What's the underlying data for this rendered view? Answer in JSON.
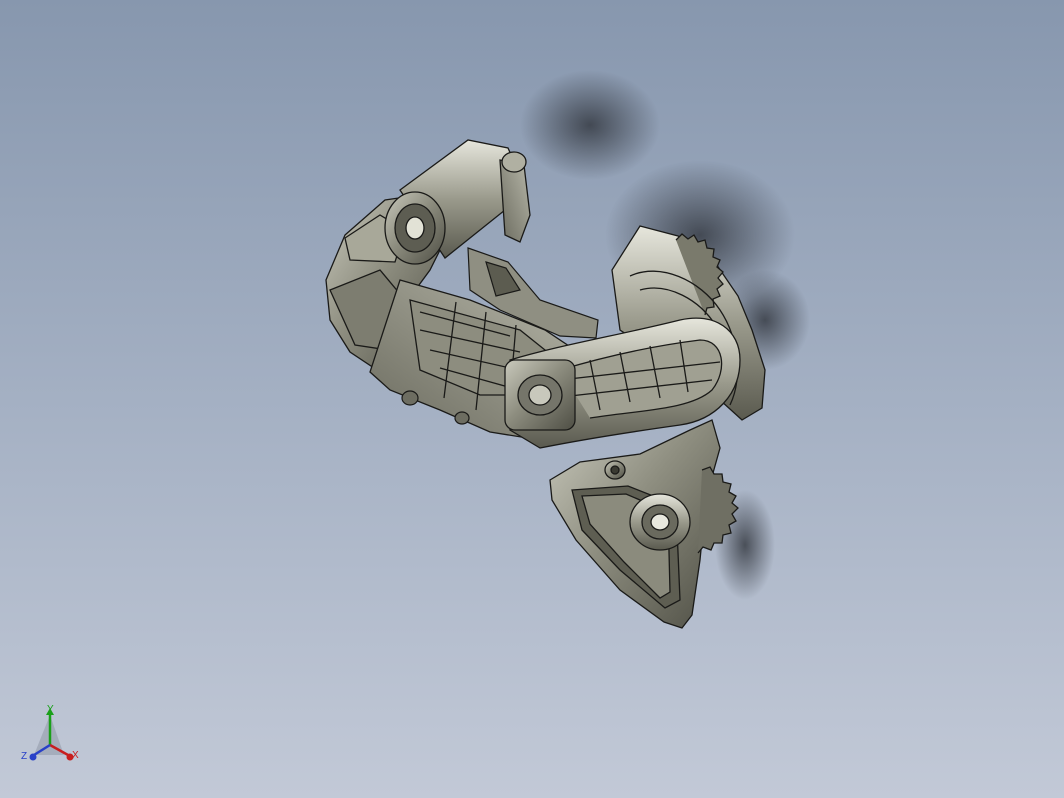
{
  "viewport": {
    "background_top": "#8797ae",
    "background_bottom": "#c2c9d7",
    "model_color": "#8f8f82",
    "edge_color": "#1a1a18"
  },
  "model": {
    "name_icon": "rear-derailleur-model"
  },
  "triad": {
    "x_label": "X",
    "y_label": "Y",
    "z_label": "Z",
    "x_color": "#c81e1e",
    "y_color": "#1aa01a",
    "z_color": "#2840c8"
  }
}
